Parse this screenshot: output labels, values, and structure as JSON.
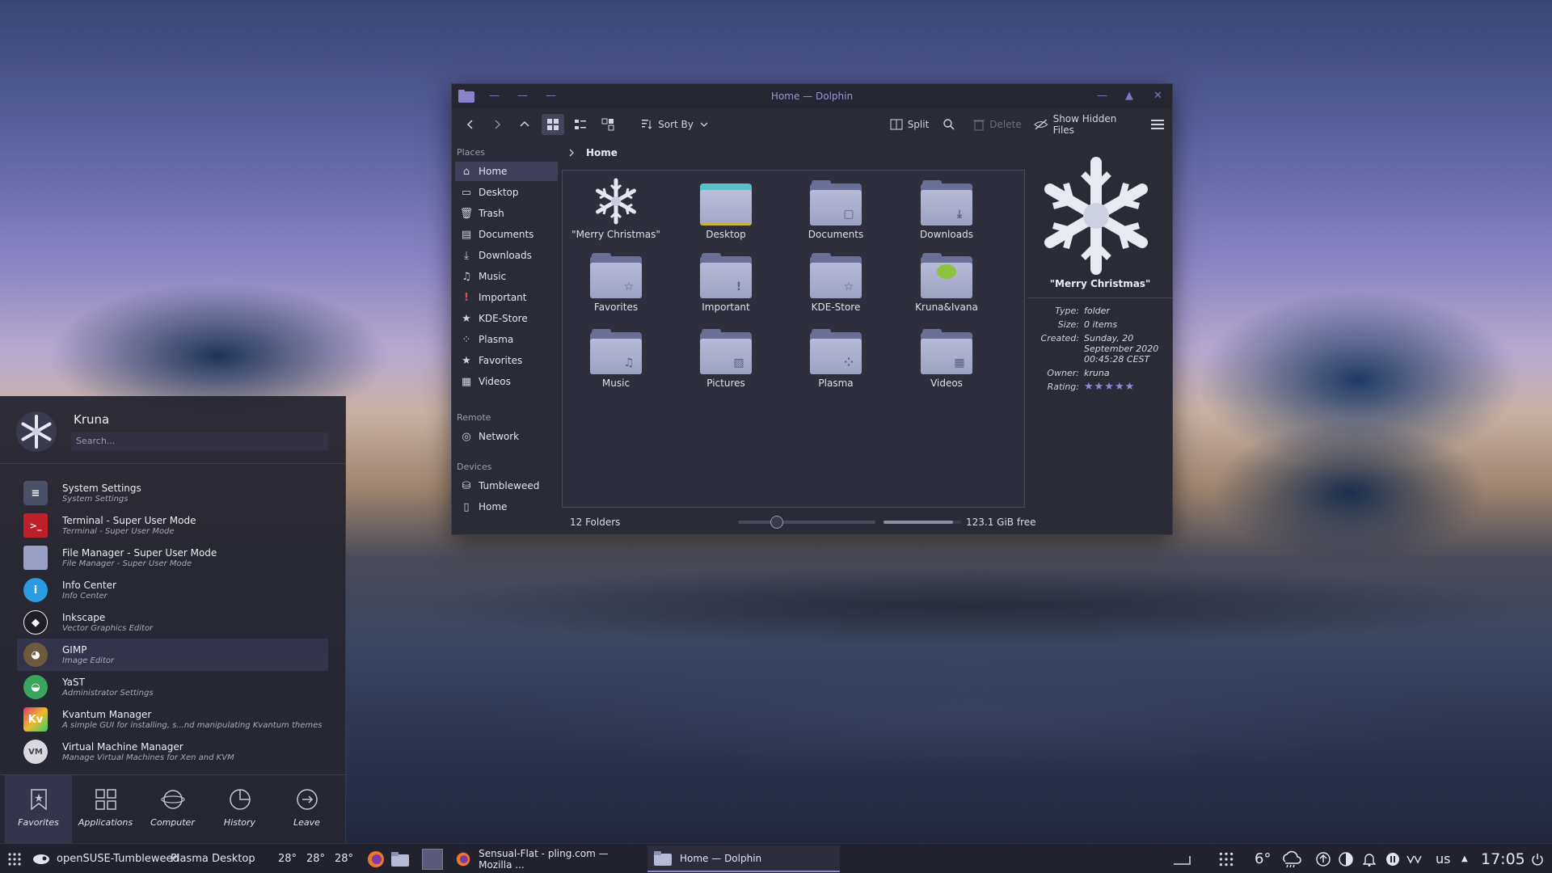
{
  "window": {
    "title": "Home — Dolphin",
    "toolbar": {
      "sort_label": "Sort By",
      "split_label": "Split",
      "delete_label": "Delete",
      "hidden_label": "Show Hidden Files"
    },
    "places": {
      "heading": "Places",
      "items": [
        "Home",
        "Desktop",
        "Trash",
        "Documents",
        "Downloads",
        "Music",
        "Important",
        "KDE-Store",
        "Plasma",
        "Favorites",
        "Videos"
      ],
      "remote_heading": "Remote",
      "remote_items": [
        "Network"
      ],
      "devices_heading": "Devices",
      "device_items": [
        "Tumbleweed",
        "Home"
      ]
    },
    "breadcrumb": "Home",
    "files": [
      "\"Merry Christmas\"",
      "Desktop",
      "Documents",
      "Downloads",
      "Favorites",
      "Important",
      "KDE-Store",
      "Kruna&Ivana",
      "Music",
      "Pictures",
      "Plasma",
      "Videos"
    ],
    "status": {
      "count": "12 Folders",
      "free": "123.1 GiB free",
      "zoom_level": 0.28,
      "disk_used_fraction": 0.9
    },
    "info": {
      "name": "\"Merry Christmas\"",
      "type_key": "Type:",
      "type_val": "folder",
      "size_key": "Size:",
      "size_val": "0 items",
      "created_key": "Created:",
      "created_val": "Sunday, 20 September 2020 00:45:28 CEST",
      "owner_key": "Owner:",
      "owner_val": "kruna",
      "rating_key": "Rating:",
      "rating_stars": 5
    }
  },
  "launcher": {
    "user": "Kruna",
    "search_placeholder": "Search...",
    "apps": [
      {
        "name": "System Settings",
        "desc": "System Settings"
      },
      {
        "name": "Terminal - Super User Mode",
        "desc": "Terminal - Super User Mode"
      },
      {
        "name": "File Manager - Super User Mode",
        "desc": "File Manager - Super User Mode"
      },
      {
        "name": "Info Center",
        "desc": "Info Center"
      },
      {
        "name": "Inkscape",
        "desc": "Vector Graphics Editor"
      },
      {
        "name": "GIMP",
        "desc": "Image Editor"
      },
      {
        "name": "YaST",
        "desc": "Administrator Settings"
      },
      {
        "name": "Kvantum Manager",
        "desc": "A simple GUI for installing, s...nd manipulating Kvantum themes"
      },
      {
        "name": "Virtual Machine Manager",
        "desc": "Manage Virtual Machines for Xen and KVM"
      }
    ],
    "tabs": [
      "Favorites",
      "Applications",
      "Computer",
      "History",
      "Leave"
    ]
  },
  "taskbar": {
    "distro": "openSUSE-Tumbleweed",
    "desktop": "Plasma Desktop",
    "temps": [
      "28°",
      "28°",
      "28°"
    ],
    "tasks": [
      "Sensual-Flat - pling.com — Mozilla ...",
      "Home — Dolphin"
    ],
    "weather": "6°",
    "keyboard": "us",
    "clock": "17:05"
  },
  "colors": {
    "accent": "#8d86d6",
    "window_bg": "#2b2b38",
    "folder": "#b6bad6"
  }
}
